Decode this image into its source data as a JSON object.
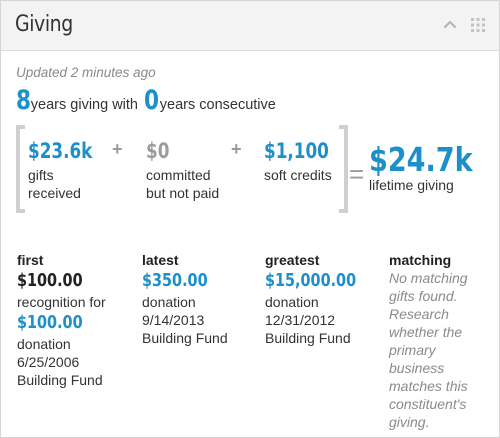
{
  "header": {
    "title": "Giving",
    "collapse_icon": "chevron-up-icon",
    "menu_icon": "grid-dots-icon"
  },
  "updated": "Updated 2 minutes ago",
  "years": {
    "giving_count": "8",
    "giving_text": "years giving with",
    "consecutive_count": "0",
    "consecutive_text": "years consecutive"
  },
  "summary": {
    "gifts_received": {
      "value": "$23.6k",
      "label_line1": "gifts",
      "label_line2": "received"
    },
    "plus1": "+",
    "committed": {
      "value": "$0",
      "label_line1": "committed",
      "label_line2": "but not paid"
    },
    "plus2": "+",
    "soft_credits": {
      "value": "$1,100",
      "label_line1": "soft credits"
    },
    "equals": "=",
    "lifetime": {
      "value": "$24.7k",
      "label": "lifetime giving"
    }
  },
  "details": {
    "first": {
      "heading": "first",
      "amount": "$100.00",
      "line1": "recognition for",
      "amount2": "$100.00",
      "line2": "donation",
      "date": "6/25/2006",
      "fund": "Building Fund"
    },
    "latest": {
      "heading": "latest",
      "amount": "$350.00",
      "type": "donation",
      "date": "9/14/2013",
      "fund": "Building Fund"
    },
    "greatest": {
      "heading": "greatest",
      "amount": "$15,000.00",
      "type": "donation",
      "date": "12/31/2012",
      "fund": "Building Fund"
    },
    "matching": {
      "heading": "matching",
      "lines": [
        "No matching",
        "gifts found.",
        "Research",
        "whether the",
        "primary",
        "business",
        "matches this",
        "constituent's",
        "giving."
      ]
    }
  },
  "colors": {
    "accent": "#1d8fc9",
    "muted": "#9b9b9b",
    "header_bg": "#f3f3f3"
  }
}
